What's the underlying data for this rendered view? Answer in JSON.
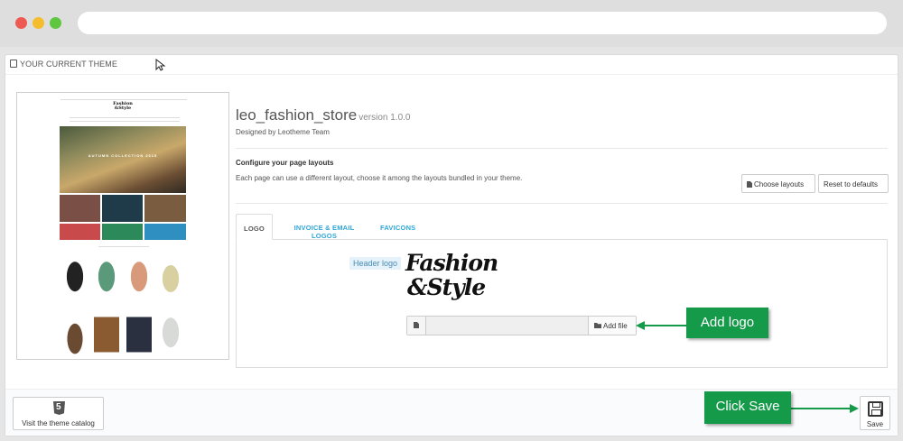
{
  "panel": {
    "heading": "YOUR CURRENT THEME"
  },
  "preview": {
    "logo_line1": "Fashion",
    "logo_line2": "&Style",
    "hero_text": "AUTUMN COLLECTION 2015"
  },
  "theme": {
    "name": "leo_fashion_store",
    "version": "version 1.0.0",
    "designer": "Designed by Leotheme Team"
  },
  "layouts": {
    "title": "Configure your page layouts",
    "description": "Each page can use a different layout, choose it among the layouts bundled in your theme.",
    "choose_label": "Choose layouts",
    "reset_label": "Reset to defaults"
  },
  "tabs": [
    {
      "label": "LOGO",
      "active": true
    },
    {
      "label": "INVOICE & EMAIL LOGOS",
      "active": false
    },
    {
      "label": "FAVICONS",
      "active": false
    }
  ],
  "logo_tab": {
    "field_label": "Header logo",
    "logo_line1": "Fashion",
    "logo_line2": "&Style",
    "file_value": "",
    "add_file_label": "Add file"
  },
  "footer": {
    "catalog_label": "Visit the theme catalog",
    "save_label": "Save"
  },
  "callouts": {
    "add_logo": "Add logo",
    "click_save": "Click Save"
  },
  "colors": {
    "accent_link": "#2fa6d9",
    "callout_green": "#159a4a",
    "label_bg": "#e5f2f9"
  },
  "icons": [
    "html5-icon",
    "save-icon",
    "document-icon",
    "folder-open-icon",
    "mouse-cursor-icon"
  ]
}
